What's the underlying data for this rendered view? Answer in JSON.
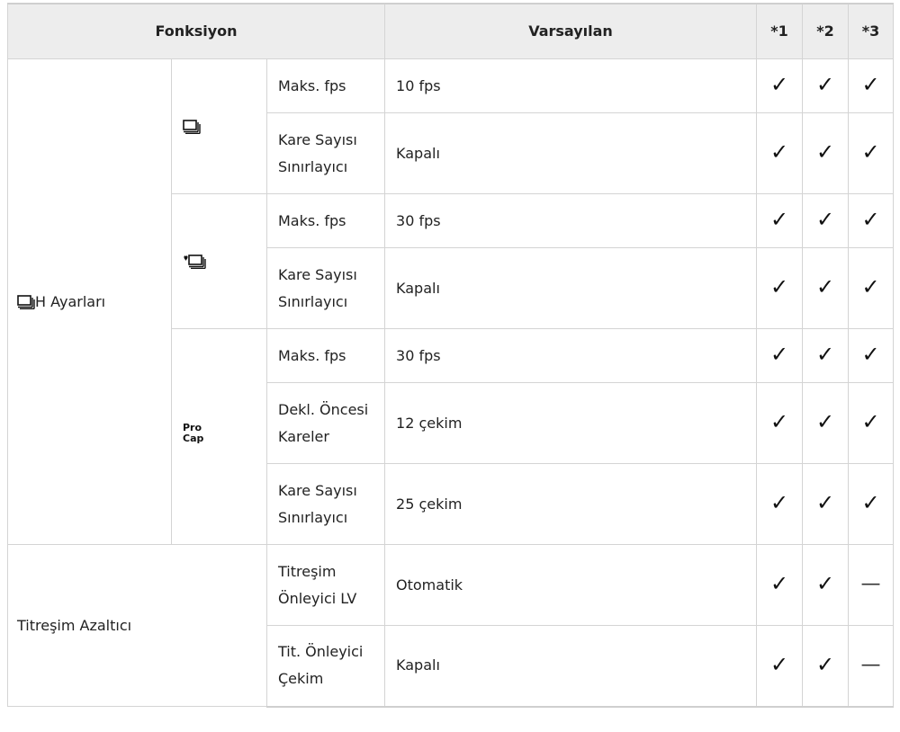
{
  "headers": {
    "function": "Fonksiyon",
    "default": "Varsayılan",
    "c1": "*1",
    "c2": "*2",
    "c3": "*3"
  },
  "groups": {
    "h_settings": "H Ayarları",
    "vibration": "Titreşim Azaltıcı"
  },
  "icons": {
    "sequential": "sequential-shooting-icon",
    "heart_sequential": "silent-sequential-icon",
    "procap": "procap-icon"
  },
  "procap_label": {
    "line1": "Pro",
    "line2": "Cap"
  },
  "symbols": {
    "check": "✓",
    "dash": "—"
  },
  "rows": [
    {
      "item": "Maks. fps",
      "value": "10 fps"
    },
    {
      "item": "Kare Sayısı Sınırlayıcı",
      "value": "Kapalı"
    },
    {
      "item": "Maks. fps",
      "value": "30 fps"
    },
    {
      "item": "Kare Sayısı Sınırlayıcı",
      "value": "Kapalı"
    },
    {
      "item": "Maks. fps",
      "value": "30 fps"
    },
    {
      "item": "Dekl. Öncesi Kareler",
      "value": "12 çekim"
    },
    {
      "item": "Kare Sayısı Sınırlayıcı",
      "value": "25 çekim"
    },
    {
      "item": "Titreşim Önleyici LV",
      "value": "Otomatik"
    },
    {
      "item": "Tit. Önleyici Çekim",
      "value": "Kapalı"
    }
  ]
}
